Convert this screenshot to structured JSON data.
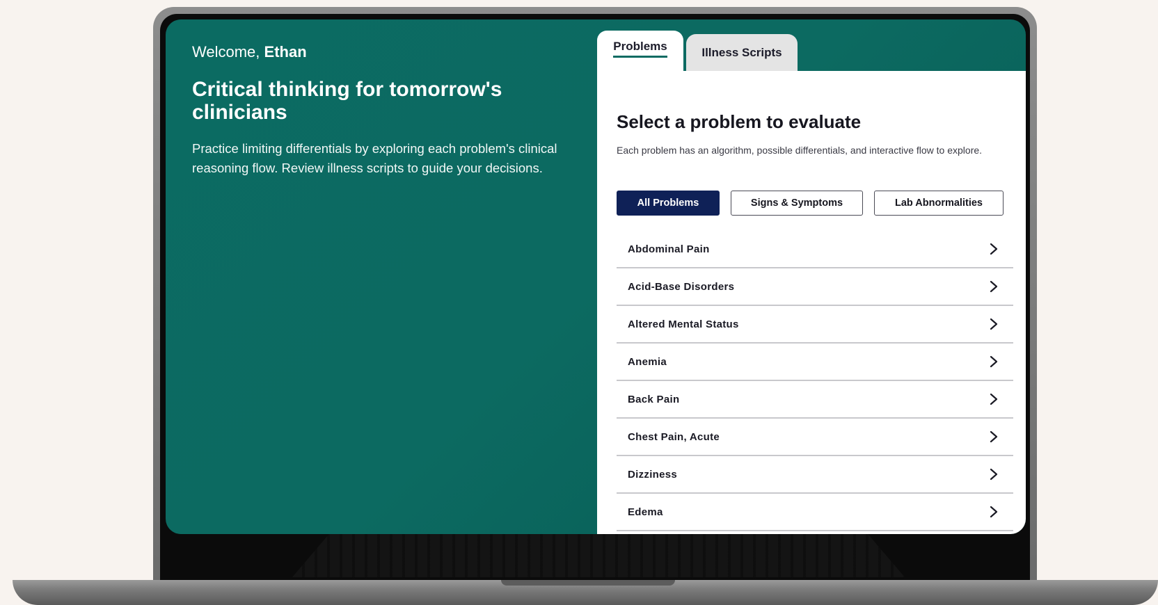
{
  "hero": {
    "welcome_prefix": "Welcome, ",
    "user_name": "Ethan",
    "headline": "Critical thinking for tomorrow's clinicians",
    "description": "Practice limiting differentials by exploring each problem's clinical reasoning flow. Review illness scripts to guide your decisions."
  },
  "tabs": [
    {
      "label": "Problems",
      "active": true
    },
    {
      "label": "Illness Scripts",
      "active": false
    }
  ],
  "panel": {
    "title": "Select a problem to evaluate",
    "subtitle": "Each problem has an algorithm, possible differentials, and interactive flow to explore."
  },
  "filters": [
    {
      "label": "All Problems",
      "selected": true
    },
    {
      "label": "Signs & Symptoms",
      "selected": false
    },
    {
      "label": "Lab Abnormalities",
      "selected": false
    }
  ],
  "problems": [
    {
      "label": "Abdominal Pain"
    },
    {
      "label": "Acid-Base Disorders"
    },
    {
      "label": "Altered Mental Status"
    },
    {
      "label": "Anemia"
    },
    {
      "label": "Back Pain"
    },
    {
      "label": "Chest Pain, Acute"
    },
    {
      "label": "Dizziness"
    },
    {
      "label": "Edema"
    }
  ],
  "icons": {
    "row_chevron": "chevron-right-icon"
  },
  "colors": {
    "brand_teal": "#0b6b62",
    "navy": "#0f2157",
    "page_bg": "#f8f3ef"
  }
}
